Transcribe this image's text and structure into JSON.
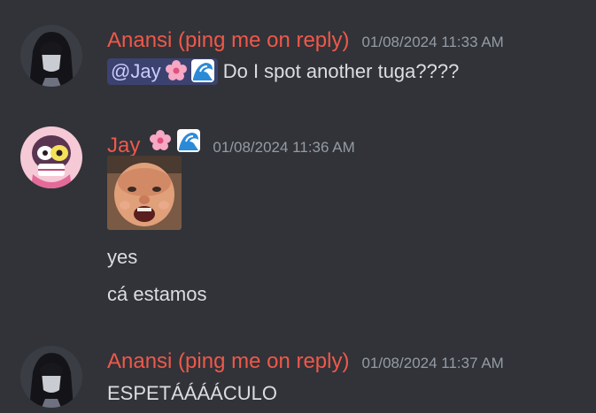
{
  "messages": [
    {
      "author": "Anansi (ping me on reply)",
      "timestamp": "01/08/2024 11:33 AM",
      "mention": "@Jay",
      "text": "Do I spot another tuga????"
    },
    {
      "author": "Jay",
      "timestamp": "01/08/2024 11:36 AM",
      "lines": [
        "yes",
        "cá estamos"
      ]
    },
    {
      "author": "Anansi (ping me on reply)",
      "timestamp": "01/08/2024 11:37 AM",
      "text": "ESPETÁÁÁÁCULO"
    }
  ],
  "icons": {
    "flower": "cherry-blossom-icon",
    "wave": "water-wave-icon"
  },
  "colors": {
    "background": "#313338",
    "username": "#f0584a",
    "timestamp": "#949ba4",
    "text": "#dbdee1",
    "mention_bg": "#3c4270",
    "mention_text": "#c9cdfb"
  }
}
